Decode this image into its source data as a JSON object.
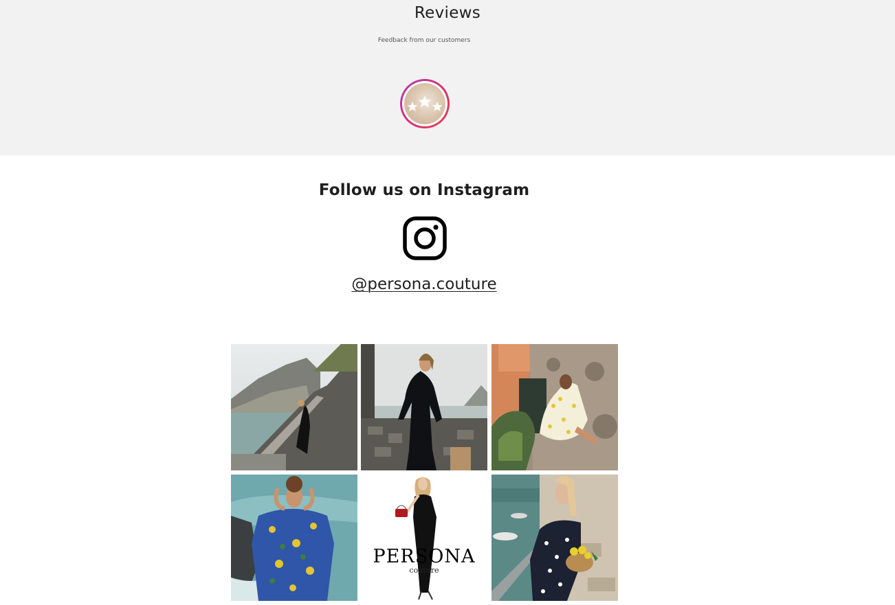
{
  "reviews": {
    "title": "Reviews",
    "subtitle": "Feedback from our customers",
    "badge_icon": "stars-icon"
  },
  "instagram": {
    "title": "Follow us on Instagram",
    "icon": "instagram-icon",
    "handle": "@persona.couture",
    "posts": [
      {
        "name": "instagram-post-1",
        "scene": "black dress on coastal stone stairs"
      },
      {
        "name": "instagram-post-2",
        "scene": "black long-sleeve dress by stone wall"
      },
      {
        "name": "instagram-post-3",
        "scene": "white dress with lemon print"
      },
      {
        "name": "instagram-post-4",
        "scene": "blue patterned wrap dress by the sea"
      },
      {
        "name": "instagram-post-5",
        "scene": "persona couture illustration"
      },
      {
        "name": "instagram-post-6",
        "scene": "polka dot dress with lemon basket"
      }
    ],
    "logo": {
      "word": "PERSONA",
      "sub": "couture"
    }
  },
  "colors": {
    "reviews_bg": "#f2f2f2",
    "badge_ring_start": "#b13bb0",
    "badge_ring_end": "#e8404f",
    "text": "#1f1f1f"
  }
}
